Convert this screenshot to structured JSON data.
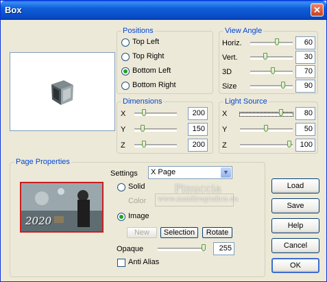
{
  "window": {
    "title": "Box",
    "close_glyph": "✕"
  },
  "positions": {
    "legend": "Positions",
    "options": [
      {
        "label": "Top Left",
        "checked": false
      },
      {
        "label": "Top Right",
        "checked": false
      },
      {
        "label": "Bottom Left",
        "checked": true
      },
      {
        "label": "Bottom Right",
        "checked": false
      }
    ]
  },
  "view_angle": {
    "legend": "View Angle",
    "horiz": {
      "label": "Horiz.",
      "value": "60"
    },
    "vert": {
      "label": "Vert.",
      "value": "30"
    },
    "3d": {
      "label": "3D",
      "value": "70"
    },
    "size": {
      "label": "Size",
      "value": "90"
    }
  },
  "dimensions": {
    "legend": "Dimensions",
    "x": {
      "label": "X",
      "value": "200"
    },
    "y": {
      "label": "Y",
      "value": "150"
    },
    "z": {
      "label": "Z",
      "value": "200"
    }
  },
  "light_source": {
    "legend": "Light Source",
    "x": {
      "label": "X",
      "value": "80"
    },
    "y": {
      "label": "Y",
      "value": "50"
    },
    "z": {
      "label": "Z",
      "value": "100"
    }
  },
  "page_properties": {
    "legend": "Page Properties",
    "settings_label": "Settings",
    "settings_value": "X Page",
    "solid_label": "Solid",
    "color_label": "Color",
    "image_label": "Image",
    "new_label": "New",
    "selection_label": "Selection",
    "rotate_label": "Rotate",
    "opaque_label": "Opaque",
    "opaque_value": "255",
    "anti_alias_label": "Anti Alias",
    "thumbnail_text": "2020"
  },
  "watermark": {
    "line1": "Pinuccia",
    "line2": "www.maidiregrafica.eu"
  },
  "buttons": {
    "load": "Load",
    "save": "Save",
    "help": "Help",
    "cancel": "Cancel",
    "ok": "OK"
  },
  "colors": {
    "legend_blue": "#0046d5",
    "titlebar_blue": "#0849c4",
    "radio_green": "#21a121",
    "thumbnail_border": "#c81e1e"
  }
}
